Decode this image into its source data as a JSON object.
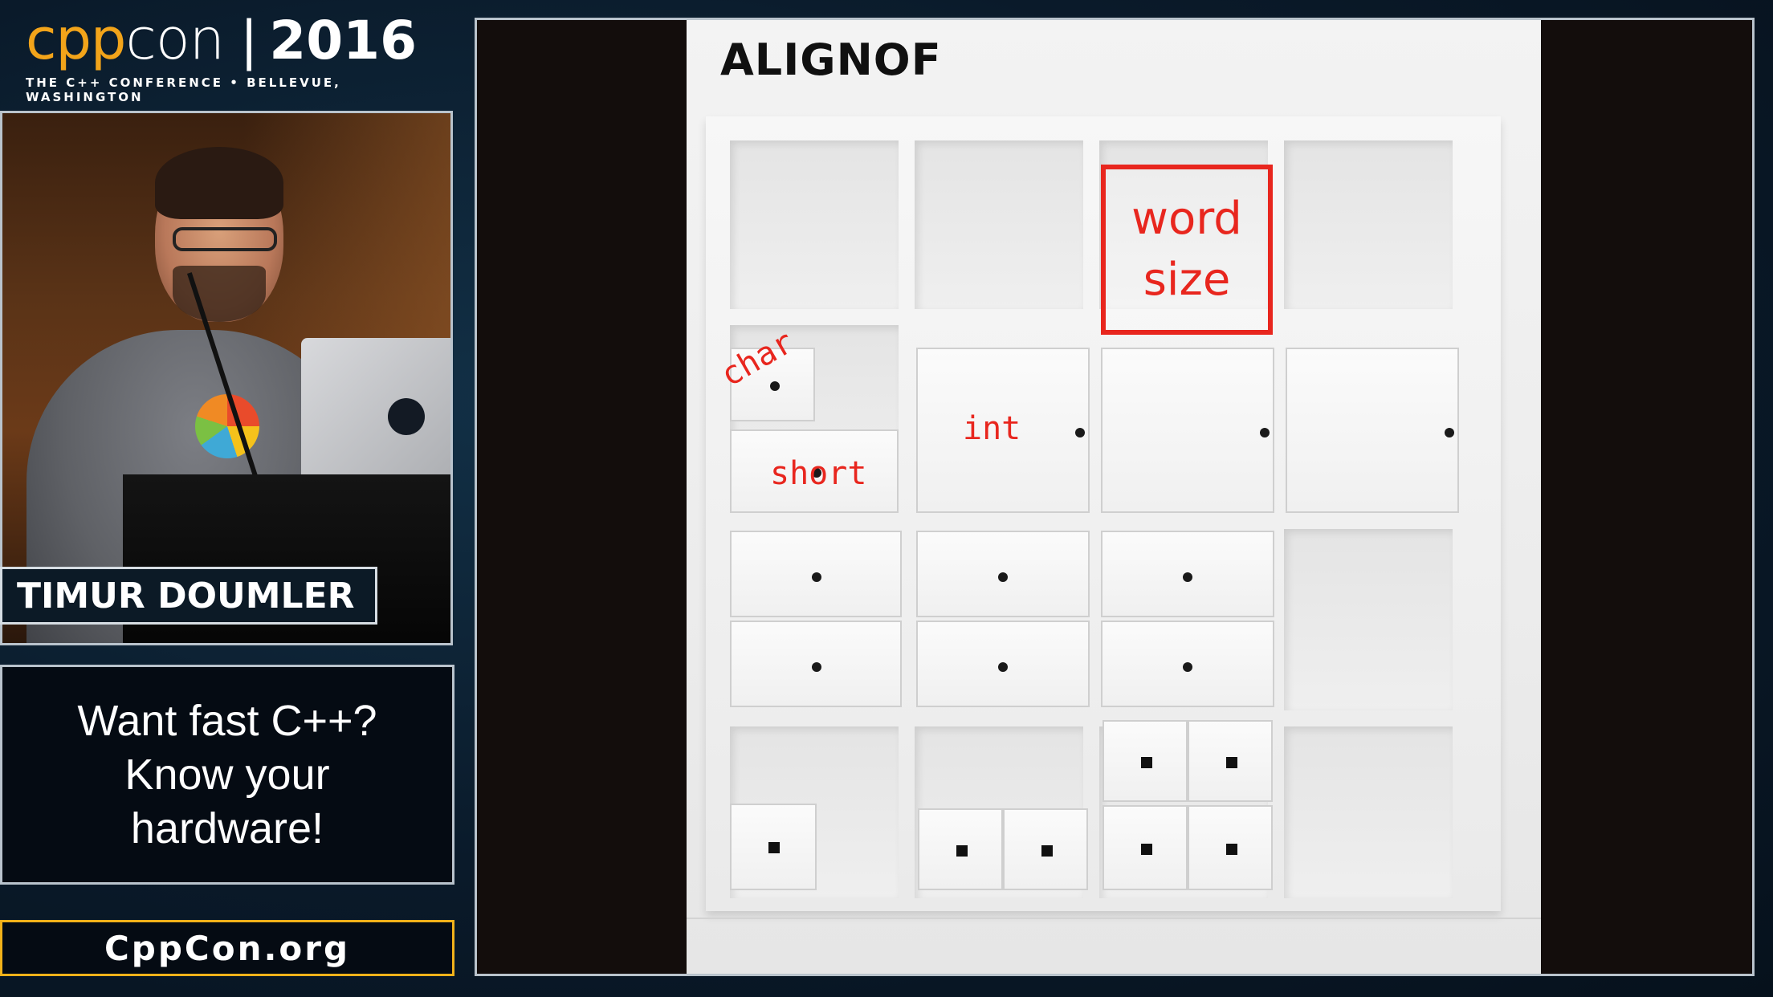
{
  "brand": {
    "logo_cpp": "cpp",
    "logo_con": "con",
    "separator": "|",
    "year": "2016",
    "tagline": "THE C++ CONFERENCE • BELLEVUE, WASHINGTON",
    "colors": {
      "cpp": "#f2a41a",
      "con": "#ffffff"
    }
  },
  "speaker": {
    "name": "TIMUR DOUMLER"
  },
  "talk": {
    "title": "Want fast C++?\nKnow your\nhardware!"
  },
  "site": {
    "url": "CppCon.org",
    "border_color": "#f2b21a"
  },
  "slide": {
    "title": "ALIGNOF",
    "labels": {
      "char": "char",
      "short": "short",
      "int": "int",
      "word_line1": "word",
      "word_line2": "size"
    },
    "accent_color": "#e8261e"
  }
}
